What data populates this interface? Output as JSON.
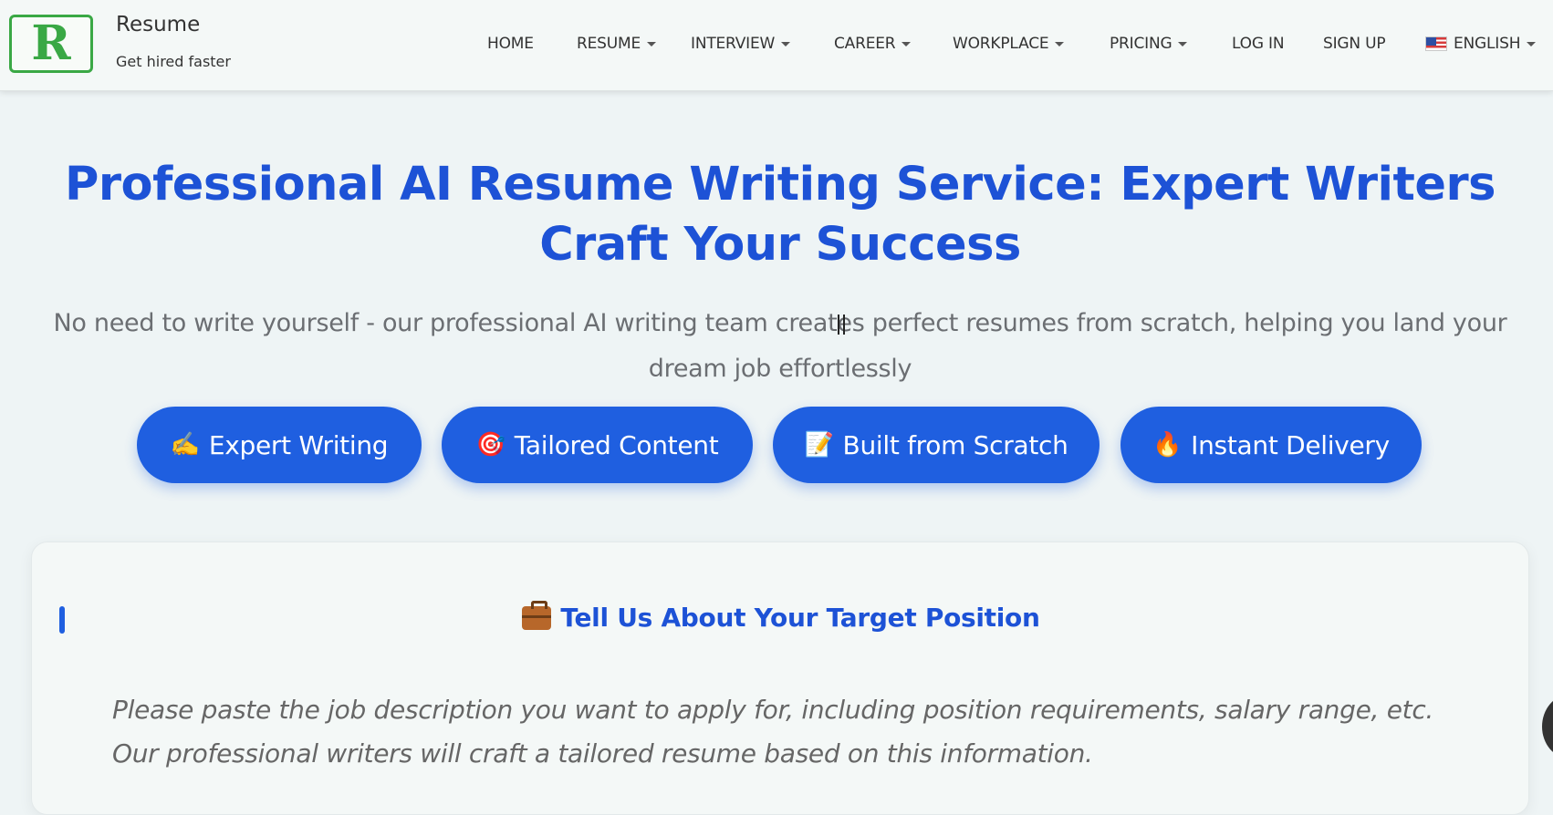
{
  "brand": {
    "logo_letter": "R",
    "name": "Resume",
    "tagline": "Get hired faster",
    "logo_color": "#3aa845"
  },
  "nav": {
    "items": [
      {
        "label": "HOME",
        "dropdown": false
      },
      {
        "label": "RESUME",
        "dropdown": true
      },
      {
        "label": "INTERVIEW",
        "dropdown": true
      },
      {
        "label": "CAREER",
        "dropdown": true
      },
      {
        "label": "WORKPLACE",
        "dropdown": true
      },
      {
        "label": "PRICING",
        "dropdown": true
      },
      {
        "label": "LOG IN",
        "dropdown": false
      },
      {
        "label": "SIGN UP",
        "dropdown": false
      }
    ],
    "language": {
      "label": "ENGLISH",
      "icon": "us-flag-icon"
    }
  },
  "hero": {
    "title": "Professional AI Resume Writing Service: Expert Writers Craft Your Success",
    "subtitle": "No need to write yourself - our professional AI writing team creates perfect resumes from scratch, helping you land your dream job effortlessly",
    "title_color": "#1d52d6"
  },
  "features": [
    {
      "icon": "✍️",
      "icon_name": "writing-hand-icon",
      "label": "Expert Writing"
    },
    {
      "icon": "🎯",
      "icon_name": "target-icon",
      "label": "Tailored Content"
    },
    {
      "icon": "📝",
      "icon_name": "memo-icon",
      "label": "Built from Scratch"
    },
    {
      "icon": "🔥",
      "icon_name": "fire-icon",
      "label": "Instant Delivery"
    }
  ],
  "card": {
    "title": "Tell Us About Your Target Position",
    "icon": "briefcase-icon",
    "description": "Please paste the job description you want to apply for, including position requirements, salary range, etc. Our professional writers will craft a tailored resume based on this information."
  },
  "colors": {
    "accent": "#1f5fe0",
    "background": "#eef4f5"
  }
}
